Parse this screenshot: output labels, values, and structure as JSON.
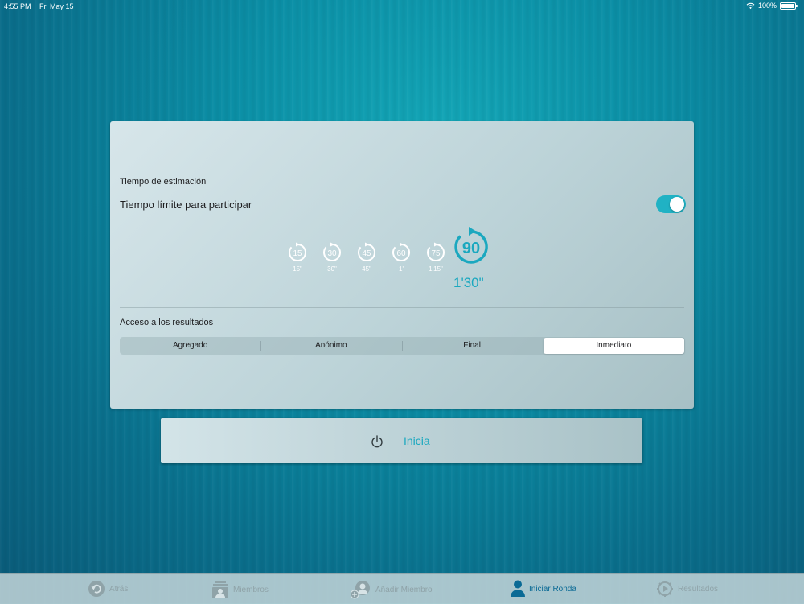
{
  "status_bar": {
    "time": "4:55 PM",
    "date": "Fri May 15",
    "battery": "100%"
  },
  "card": {
    "estimation_title": "Tiempo de estimación",
    "limit_label": "Tiempo límite para participar",
    "limit_enabled": true,
    "timer_options": [
      {
        "value": "15",
        "caption": "15\""
      },
      {
        "value": "30",
        "caption": "30\""
      },
      {
        "value": "45",
        "caption": "45\""
      },
      {
        "value": "60",
        "caption": "1'"
      },
      {
        "value": "75",
        "caption": "1'15\""
      }
    ],
    "selected_timer": {
      "value": "90",
      "caption": "1'30\""
    },
    "results_title": "Acceso a los resultados",
    "results_options": [
      "Agregado",
      "Anónimo",
      "Final",
      "Inmediato"
    ],
    "results_selected": "Inmediato"
  },
  "start_button": {
    "label": "Inicia",
    "icon": "power-icon"
  },
  "tab_bar": {
    "tabs": [
      {
        "label": "Atrás",
        "icon": "back-icon",
        "active": false
      },
      {
        "label": "Miembros",
        "icon": "members-icon",
        "active": false
      },
      {
        "label": "Añadir Miembro",
        "icon": "add-member-icon",
        "active": false
      },
      {
        "label": "Iniciar Ronda",
        "icon": "person-icon",
        "active": true
      },
      {
        "label": "Resultados",
        "icon": "results-icon",
        "active": false
      }
    ]
  },
  "colors": {
    "accent": "#1ba8bf",
    "tab_active": "#0a6a95",
    "toggle_on": "#20b2c4"
  }
}
